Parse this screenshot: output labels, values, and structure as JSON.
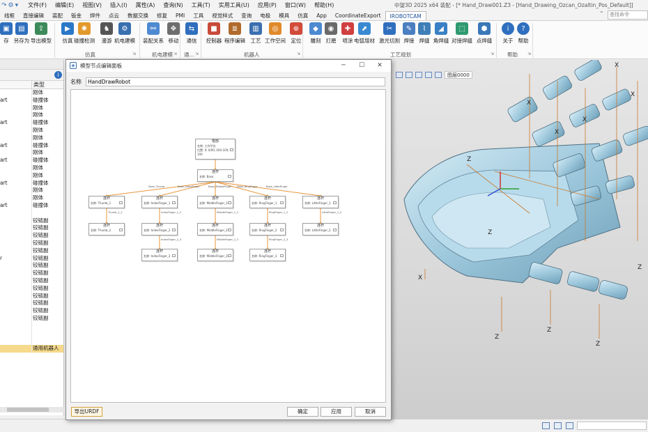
{
  "menubar": {
    "items": [
      "文件(F)",
      "编辑(E)",
      "视图(V)",
      "插入(I)",
      "属性(A)",
      "查询(N)",
      "工具(T)",
      "实用工具(U)",
      "应用(P)",
      "窗口(W)",
      "帮助(H)"
    ],
    "window_title": "中望3D 2025 x64    装配 - [* Hand_Draw001.Z3 - [Hand_Drawing_Ozcan_Ozaltin_Pos_Default]]"
  },
  "ribbon_tabs": {
    "items": [
      "线框",
      "直接编辑",
      "装配",
      "钣金",
      "焊件",
      "点云",
      "数据交换",
      "修复",
      "PMI",
      "工具",
      "视觉样式",
      "查询",
      "电极",
      "模具",
      "仿真",
      "App",
      "CoordinateExport",
      "IROBOTCAM"
    ],
    "active_index": 17,
    "search_placeholder": "查找命令"
  },
  "ribbon": {
    "buttons": [
      {
        "label": "存",
        "icon": "save-icon",
        "color": "#2f6fbe"
      },
      {
        "label": "另存为",
        "icon": "save-as-icon",
        "color": "#2f6fbe"
      },
      {
        "label": "导出模型",
        "icon": "export-model-icon",
        "color": "#3c8a5a"
      },
      {
        "label": "仿真",
        "icon": "play-icon",
        "color": "#2b78c8"
      },
      {
        "label": "碰撞检测",
        "icon": "collision-icon",
        "color": "#e39a2c"
      },
      {
        "label": "漫游",
        "icon": "roam-icon",
        "color": "#555555"
      },
      {
        "label": "机电建模",
        "icon": "mechatronic-icon",
        "color": "#3a6fb0"
      },
      {
        "label": "装配关系",
        "icon": "assembly-relation-icon",
        "color": "#4d8ad1"
      },
      {
        "label": "移动",
        "icon": "move-icon",
        "color": "#6d6d6d"
      },
      {
        "label": "通信",
        "icon": "communication-icon",
        "color": "#2f6fbe"
      },
      {
        "label": "控制器",
        "icon": "controller-icon",
        "color": "#c84a3a"
      },
      {
        "label": "程序编辑",
        "icon": "program-edit-icon",
        "color": "#b06a2c"
      },
      {
        "label": "工艺",
        "icon": "process-icon",
        "color": "#3a6fb0"
      },
      {
        "label": "工作空间",
        "icon": "workspace-icon",
        "color": "#e08a2c"
      },
      {
        "label": "定位",
        "icon": "locate-icon",
        "color": "#d24b3a"
      },
      {
        "label": "雕刻",
        "icon": "engrave-icon",
        "color": "#4d8ad1"
      },
      {
        "label": "打磨",
        "icon": "grind-icon",
        "color": "#6a6a6a"
      },
      {
        "label": "喷涂",
        "icon": "spray-icon",
        "color": "#d04040"
      },
      {
        "label": "电弧增材",
        "icon": "arc-additive-icon",
        "color": "#3a8ad1"
      },
      {
        "label": "激光切割",
        "icon": "laser-cut-icon",
        "color": "#2f6fbe"
      },
      {
        "label": "焊接",
        "icon": "weld-icon",
        "color": "#4a7fc0"
      },
      {
        "label": "焊缝",
        "icon": "weld-seam-icon",
        "color": "#3f7fb8"
      },
      {
        "label": "角焊缝",
        "icon": "fillet-weld-icon",
        "color": "#3a80c4"
      },
      {
        "label": "对接焊缝",
        "icon": "butt-weld-icon",
        "color": "#2f9a70"
      },
      {
        "label": "点焊缝",
        "icon": "spot-weld-icon",
        "color": "#3a78b8"
      },
      {
        "label": "关于",
        "icon": "info-icon",
        "color": "#2f6fbe"
      },
      {
        "label": "帮助",
        "icon": "help-icon",
        "color": "#2f6fbe"
      }
    ],
    "groups": [
      "仿真",
      "机电建模",
      "通...",
      "机器人",
      "工艺规划",
      "帮助"
    ]
  },
  "left_panel": {
    "column_header": "类型",
    "rows": [
      {
        "c1": "",
        "c2": "刚体"
      },
      {
        "c1": "art",
        "c2": "碰撞体"
      },
      {
        "c1": "",
        "c2": "刚体"
      },
      {
        "c1": "",
        "c2": "刚体"
      },
      {
        "c1": "art",
        "c2": "碰撞体"
      },
      {
        "c1": "",
        "c2": "刚体"
      },
      {
        "c1": "",
        "c2": "刚体"
      },
      {
        "c1": "art",
        "c2": "碰撞体"
      },
      {
        "c1": "",
        "c2": "刚体"
      },
      {
        "c1": "art",
        "c2": "碰撞体"
      },
      {
        "c1": "",
        "c2": "刚体"
      },
      {
        "c1": "",
        "c2": "刚体"
      },
      {
        "c1": "art",
        "c2": "碰撞体"
      },
      {
        "c1": "",
        "c2": "刚体"
      },
      {
        "c1": "",
        "c2": "刚体"
      },
      {
        "c1": "art",
        "c2": "碰撞体"
      },
      {
        "c1": "",
        "c2": ""
      },
      {
        "c1": "",
        "c2": "铰链副"
      },
      {
        "c1": "",
        "c2": "铰链副"
      },
      {
        "c1": "",
        "c2": "铰链副"
      },
      {
        "c1": "",
        "c2": "铰链副"
      },
      {
        "c1": "",
        "c2": "铰链副"
      },
      {
        "c1": "r",
        "c2": "铰链副"
      },
      {
        "c1": "",
        "c2": "铰链副"
      },
      {
        "c1": "",
        "c2": "铰链副"
      },
      {
        "c1": "",
        "c2": "铰链副"
      },
      {
        "c1": "",
        "c2": "铰链副"
      },
      {
        "c1": "",
        "c2": "铰链副"
      },
      {
        "c1": "",
        "c2": "铰链副"
      },
      {
        "c1": "",
        "c2": "铰链副"
      },
      {
        "c1": "",
        "c2": "铰链副"
      },
      {
        "c1": "",
        "c2": ""
      },
      {
        "c1": "",
        "c2": ""
      },
      {
        "c1": "",
        "c2": ""
      },
      {
        "c1": "",
        "c2": "通用机器人",
        "selected": true
      }
    ]
  },
  "viewport_toolbar": {
    "layer_label": "图层0000"
  },
  "dialog": {
    "title": "模型节点编辑面板",
    "name_label": "名称",
    "name_value": "HandDrawRobot",
    "export_button": "导出URDF",
    "ok_button": "确定",
    "apply_button": "应用",
    "cancel_button": "取消",
    "graph": {
      "root": {
        "title": "根部",
        "lines": [
          "名称: 工作平台",
          "位置: 0; 0/00; 0/0/-100; 100"
        ]
      },
      "base": {
        "title": "连杆",
        "text": "名称: Base"
      },
      "edge_labels": [
        "Base_Thumb",
        "Base_IndexFinger",
        "Base_MiddleFinger",
        "Base_RingFinger",
        "Base_LittleFinger"
      ],
      "branches": [
        {
          "nodes": [
            "Thumb_1",
            "Thumb_2"
          ],
          "edge_labels": [
            "Thumb_1_2"
          ]
        },
        {
          "nodes": [
            "IndexFinger_1",
            "IndexFinger_2",
            "IndexFinger_3"
          ],
          "edge_labels": [
            "IndexFinger_1_2",
            "IndexFinger_2_3"
          ]
        },
        {
          "nodes": [
            "MiddleFinger_1",
            "MiddleFinger_2",
            "MiddleFinger_3"
          ],
          "edge_labels": [
            "MiddleFinger_1_2",
            "MiddleFinger_2_3"
          ]
        },
        {
          "nodes": [
            "RingFinger_1",
            "RingFinger_2",
            "RingFinger_3"
          ],
          "edge_labels": [
            "RingFinger_1_2",
            "RingFinger_2_3"
          ]
        },
        {
          "nodes": [
            "LittleFinger_1",
            "LittleFinger_2"
          ],
          "edge_labels": [
            "LittleFinger_1_2"
          ]
        }
      ],
      "node_title": "连杆",
      "node_prefix": "名称:"
    }
  }
}
